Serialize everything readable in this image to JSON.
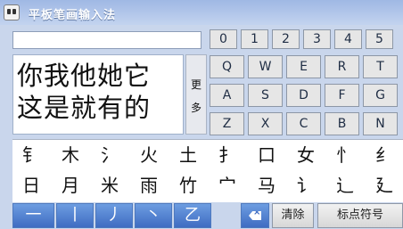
{
  "window": {
    "title": "平板笔画输入法"
  },
  "input": {
    "placeholder": ""
  },
  "candidates": {
    "row1": "你我他她它",
    "row2": "这是就有的",
    "more_1": "更",
    "more_2": "多"
  },
  "numbers": [
    "0",
    "1",
    "2",
    "3",
    "4",
    "5"
  ],
  "letters": [
    "Q",
    "W",
    "E",
    "R",
    "T",
    "A",
    "S",
    "D",
    "F",
    "G",
    "Z",
    "X",
    "C",
    "B",
    "N"
  ],
  "radicals_row1": [
    "钅",
    "木",
    "氵",
    "火",
    "土",
    "扌",
    "口",
    "女",
    "忄",
    "纟"
  ],
  "radicals_row2": [
    "日",
    "月",
    "米",
    "雨",
    "竹",
    "宀",
    "马",
    "讠",
    "辶",
    "廴"
  ],
  "strokes": [
    "一",
    "丨",
    "丿",
    "丶",
    "乙"
  ],
  "buttons": {
    "clear": "清除",
    "punctuation": "标点符号"
  }
}
